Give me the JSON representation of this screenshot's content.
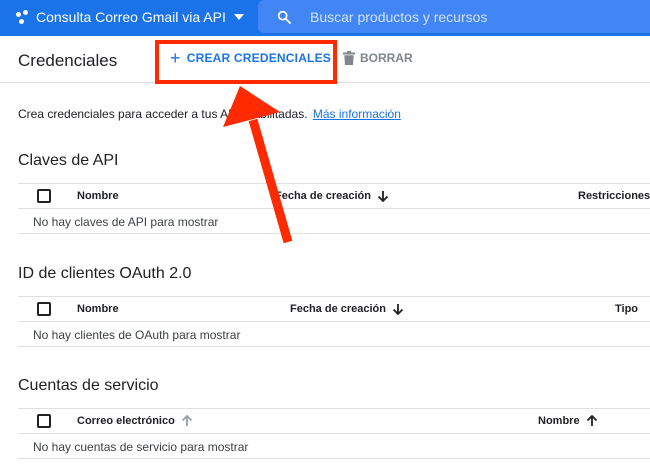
{
  "topbar": {
    "project_name": "Consulta Correo Gmail via API",
    "search_placeholder": "Buscar productos y recursos"
  },
  "header": {
    "title": "Credenciales",
    "create_label": "CREAR CREDENCIALES",
    "delete_label": "BORRAR"
  },
  "intro": {
    "text": "Crea credenciales para acceder a tus API",
    "hidden_fragment": "habilitadas.",
    "link": "Más información"
  },
  "sections": {
    "api_keys": {
      "title": "Claves de API",
      "col_name": "Nombre",
      "col_date": "Fecha de creación",
      "col_restrictions": "Restricciones",
      "empty": "No hay claves de API para mostrar"
    },
    "oauth": {
      "title": "ID de clientes OAuth 2.0",
      "col_name": "Nombre",
      "col_date": "Fecha de creación",
      "col_type": "Tipo",
      "empty": "No hay clientes de OAuth para mostrar"
    },
    "service": {
      "title": "Cuentas de servicio",
      "col_email": "Correo electrónico",
      "col_name": "Nombre",
      "empty": "No hay cuentas de servicio para mostrar"
    }
  },
  "colors": {
    "brand": "#1a73e8",
    "search_bg": "#4285f4",
    "annotation": "#ff2a00"
  }
}
